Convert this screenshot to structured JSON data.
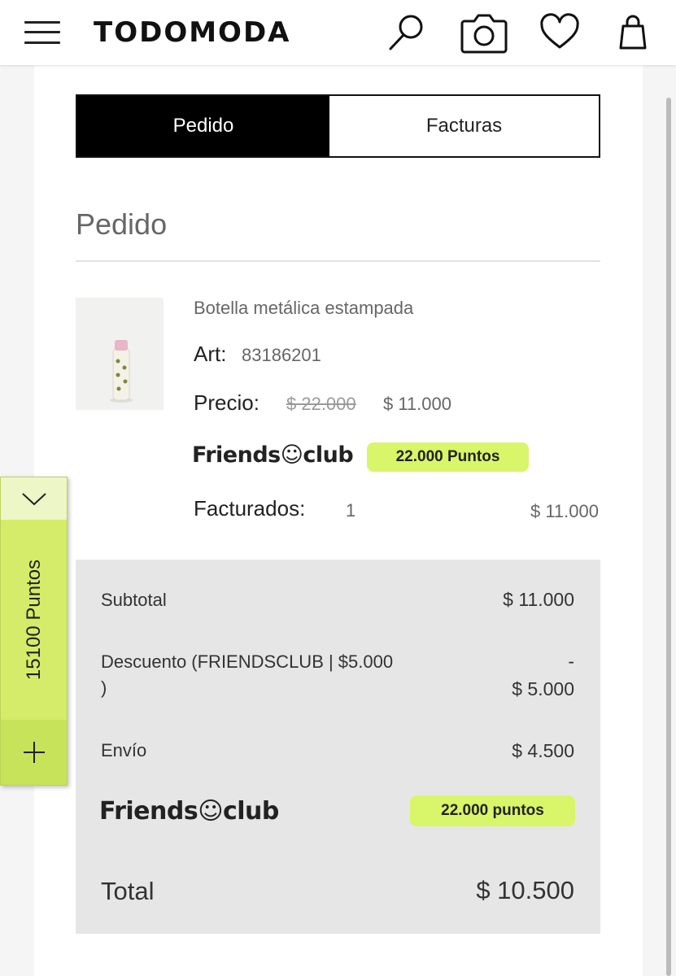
{
  "header": {
    "brand": "TODOMODA",
    "icons": [
      "menu-icon",
      "search-icon",
      "camera-icon",
      "heart-icon",
      "bag-icon"
    ]
  },
  "tabs": [
    {
      "label": "Pedido",
      "active": true
    },
    {
      "label": "Facturas",
      "active": false
    }
  ],
  "section_title": "Pedido",
  "product": {
    "name": "Botella metálica estampada",
    "art_label": "Art:",
    "art_value": "83186201",
    "price_label": "Precio:",
    "price_original": "$ 22.000",
    "price_current": "$ 11.000",
    "friends_club": "Friends☺club",
    "points_badge": "22.000 Puntos",
    "facturados_label": "Facturados:",
    "facturados_qty": "1",
    "facturados_total": "$ 11.000"
  },
  "summary": {
    "subtotal_label": "Subtotal",
    "subtotal_value": "$ 11.000",
    "discount_label_line1": "Descuento (FRIENDSCLUB | $5.000",
    "discount_label_line2": ")",
    "discount_value_line1": "-",
    "discount_value_line2": "$ 5.000",
    "shipping_label": "Envío",
    "shipping_value": "$ 4.500",
    "friends_club": "Friends☺club",
    "points_badge": "22.000 puntos",
    "total_label": "Total",
    "total_value": "$ 10.500"
  },
  "points_widget": {
    "text": "15100  Puntos",
    "collapse_icon": "chevron-down-icon",
    "add_icon": "plus-icon"
  },
  "colors": {
    "accent_green": "#d9f56a",
    "tab_active_bg": "#000000",
    "summary_bg": "#e6e6e6"
  }
}
